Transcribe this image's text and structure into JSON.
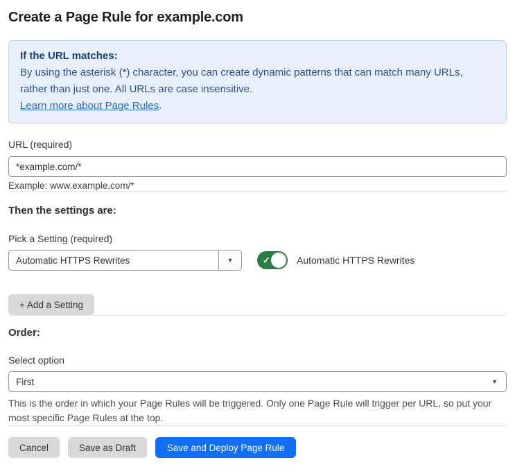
{
  "page": {
    "title": "Create a Page Rule for example.com"
  },
  "info_box": {
    "heading": "If the URL matches:",
    "body": "By using the asterisk (*) character, you can create dynamic patterns that can match many URLs, rather than just one. All URLs are case insensitive.",
    "link_label": "Learn more about Page Rules",
    "link_suffix": "."
  },
  "url_field": {
    "label": "URL (required)",
    "value": "*example.com/*",
    "example": "Example: www.example.com/*"
  },
  "settings": {
    "heading": "Then the settings are:",
    "picker_label": "Pick a Setting (required)",
    "picker_value": "Automatic HTTPS Rewrites",
    "toggle_label": "Automatic HTTPS Rewrites",
    "toggle_state": "on",
    "add_button_label": "+ Add a Setting"
  },
  "order": {
    "heading": "Order:",
    "select_label": "Select option",
    "select_value": "First",
    "help_text": "This is the order in which your Page Rules will be triggered. Only one Page Rule will trigger per URL, so put your most specific Page Rules at the top."
  },
  "footer": {
    "cancel_label": "Cancel",
    "save_draft_label": "Save as Draft",
    "save_deploy_label": "Save and Deploy Page Rule"
  },
  "icons": {
    "dropdown_arrow": "▼",
    "check": "✓"
  },
  "colors": {
    "accent_blue": "#146ef5",
    "info_background": "#e8f1fb",
    "info_border": "#b9d8f3",
    "info_heading_text": "#1a3c77",
    "info_body_text": "#2d4f8a",
    "link_blue": "#2765cc",
    "toggle_green": "#2d7d46",
    "gray_button": "#d9d9d9",
    "input_border": "#8d9199"
  }
}
